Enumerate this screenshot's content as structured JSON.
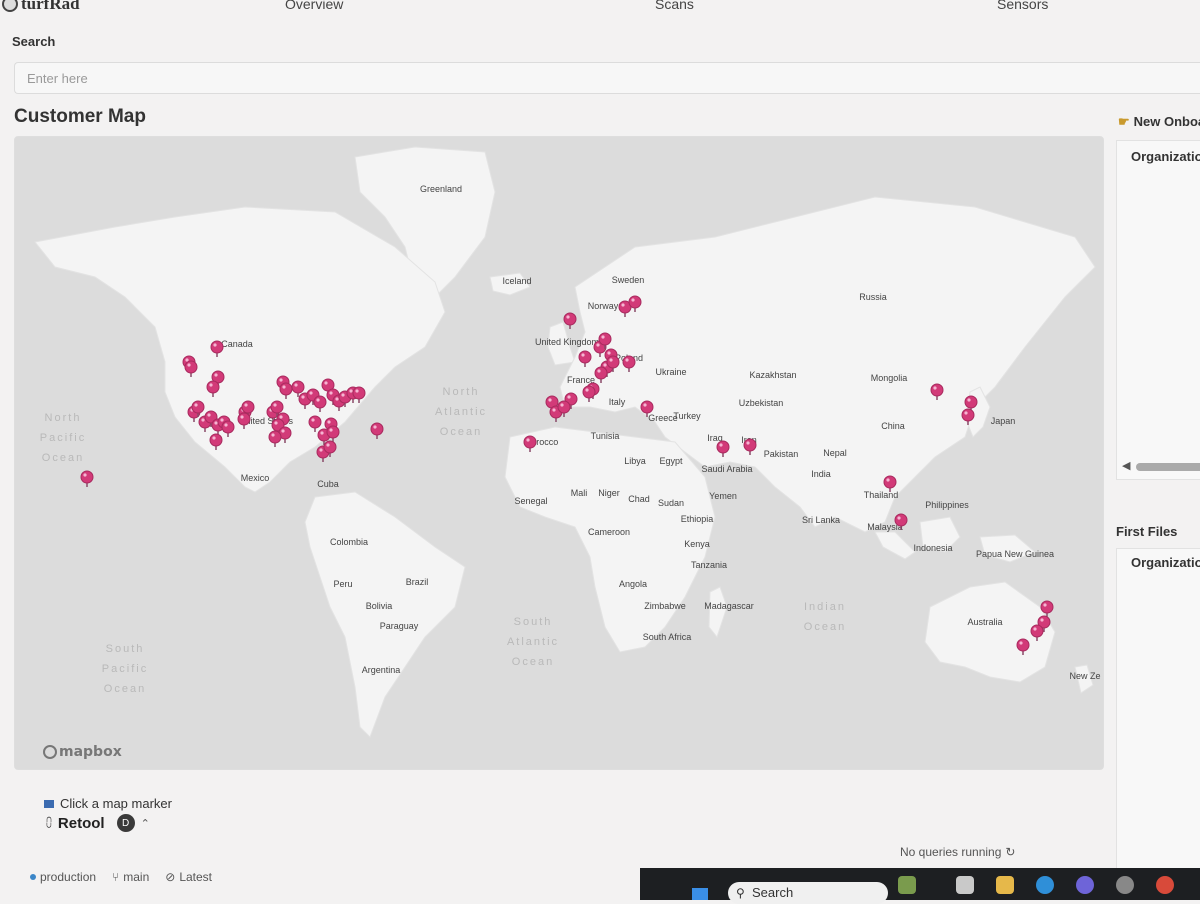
{
  "app": {
    "name": "turfRad"
  },
  "nav": {
    "items": [
      "Overview",
      "Scans",
      "Sensors"
    ]
  },
  "search": {
    "label": "Search",
    "placeholder": "Enter here"
  },
  "map": {
    "title": "Customer Map",
    "attribution": "mapbox",
    "hint": "Click a map marker",
    "marker_color": "#d23a78",
    "labels": {
      "greenland": "Greenland",
      "iceland": "Iceland",
      "canada": "Canada",
      "united_states": "United States",
      "mexico": "Mexico",
      "cuba": "Cuba",
      "colombia": "Colombia",
      "peru": "Peru",
      "brazil": "Brazil",
      "bolivia": "Bolivia",
      "paraguay": "Paraguay",
      "argentina": "Argentina",
      "sweden": "Sweden",
      "norway": "Norway",
      "united_kingdom": "United Kingdom",
      "france": "France",
      "poland": "Poland",
      "ukraine": "Ukraine",
      "italy": "Italy",
      "greece": "Greece",
      "turkey": "Turkey",
      "tunisia": "Tunisia",
      "morocco": "Morocco",
      "libya": "Libya",
      "egypt": "Egypt",
      "iraq": "Iraq",
      "iran": "Iran",
      "saudi_arabia": "Saudi Arabia",
      "yemen": "Yemen",
      "senegal": "Senegal",
      "mali": "Mali",
      "niger": "Niger",
      "chad": "Chad",
      "sudan": "Sudan",
      "ethiopia": "Ethiopia",
      "cameroon": "Cameroon",
      "kenya": "Kenya",
      "tanzania": "Tanzania",
      "angola": "Angola",
      "zimbabwe": "Zimbabwe",
      "madagascar": "Madagascar",
      "south_africa": "South Africa",
      "russia": "Russia",
      "kazakhstan": "Kazakhstan",
      "uzbekistan": "Uzbekistan",
      "mongolia": "Mongolia",
      "china": "China",
      "japan": "Japan",
      "pakistan": "Pakistan",
      "nepal": "Nepal",
      "india": "India",
      "sri_lanka": "Sri Lanka",
      "thailand": "Thailand",
      "malaysia": "Malaysia",
      "philippines": "Philippines",
      "indonesia": "Indonesia",
      "papua_new_guinea": "Papua New Guinea",
      "australia": "Australia",
      "new_zealand": "New Ze",
      "north_pacific_ocean": "North Pacific Ocean",
      "north_atlantic_ocean": "North Atlantic Ocean",
      "south_atlantic_ocean": "South Atlantic Ocean",
      "south_pacific_ocean": "South Pacific Ocean",
      "indian_ocean": "Indian Ocean"
    }
  },
  "footer": {
    "brand": "Retool",
    "badge": "D",
    "status": "No queries running",
    "env": "production",
    "branch": "main",
    "release": "Latest"
  },
  "right_panel": {
    "header": "New Onboa",
    "column": "Organization",
    "section2": "First Files",
    "column2": "Organization"
  },
  "taskbar": {
    "search_placeholder": "Search"
  }
}
